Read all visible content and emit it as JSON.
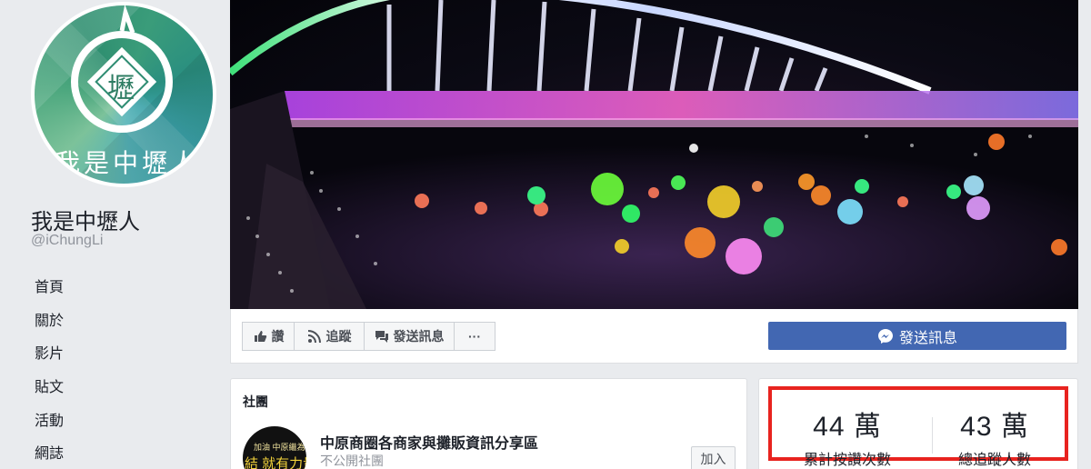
{
  "page": {
    "name": "我是中壢人",
    "handle": "@iChungLi",
    "avatar_text": "我是中壢人",
    "avatar_seal_char": "壢"
  },
  "nav": {
    "items": [
      {
        "label": "首頁"
      },
      {
        "label": "關於"
      },
      {
        "label": "影片"
      },
      {
        "label": "貼文"
      },
      {
        "label": "活動"
      },
      {
        "label": "網誌"
      }
    ]
  },
  "actions": {
    "like": "讚",
    "follow": "追蹤",
    "message": "發送訊息",
    "more": "···",
    "send_message_primary": "發送訊息"
  },
  "groups": {
    "title": "社團",
    "item": {
      "name": "中原商圈各商家與攤販資訊分享區",
      "type": "不公開社團",
      "join_label": "加入",
      "thumb_line1": "加油 中原繼為！",
      "thumb_line2": "結 就有力量"
    }
  },
  "stats": {
    "likes_value": "44 萬",
    "likes_label": "累計按讚次數",
    "followers_value": "43 萬",
    "followers_label": "總追蹤人數"
  },
  "colors": {
    "primary_button": "#4267b2",
    "highlight_border": "#e8231f",
    "background": "#e9ebee"
  }
}
